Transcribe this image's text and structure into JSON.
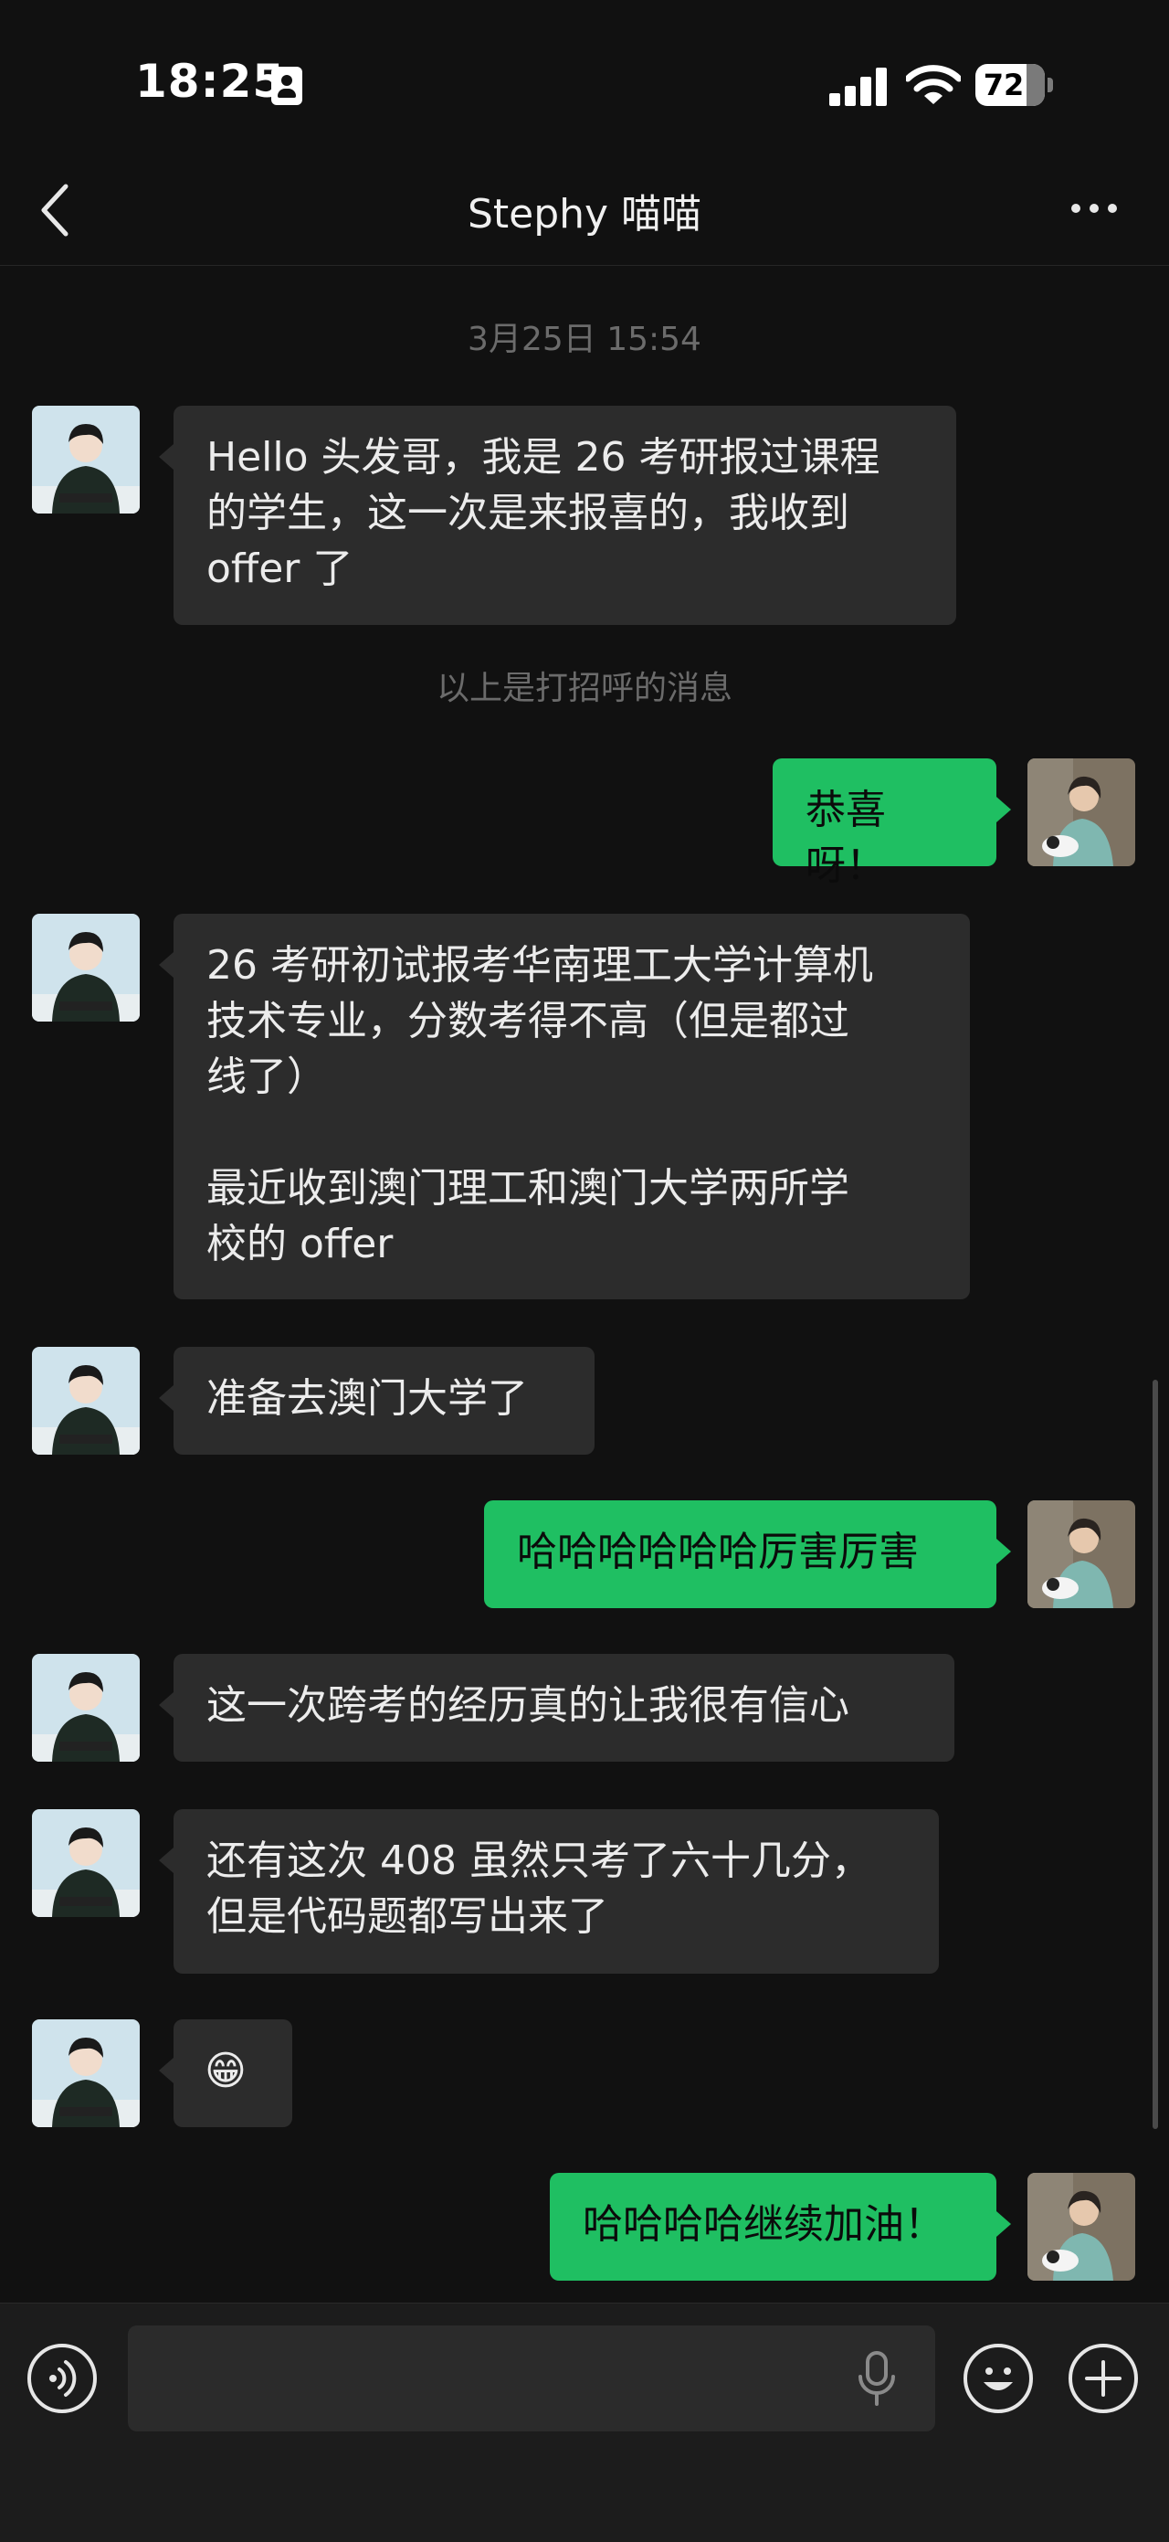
{
  "status_bar": {
    "time": "18:25",
    "battery": "72"
  },
  "header": {
    "title": "Stephy 喵喵"
  },
  "timestamp": "3月25日 15:54",
  "system_message": "以上是打招呼的消息",
  "messages": [
    {
      "side": "in",
      "text": "Hello 头发哥，我是 26 考研报过课程\n的学生，这一次是来报喜的，我收到\noffer 了"
    },
    {
      "side": "out",
      "text": "恭喜呀！"
    },
    {
      "side": "in",
      "text": "26 考研初试报考华南理工大学计算机\n技术专业，分数考得不高（但是都过\n线了）\n\n最近收到澳门理工和澳门大学两所学\n校的 offer"
    },
    {
      "side": "in",
      "text": "准备去澳门大学了"
    },
    {
      "side": "out",
      "text": "哈哈哈哈哈哈厉害厉害"
    },
    {
      "side": "in",
      "text": "这一次跨考的经历真的让我很有信心"
    },
    {
      "side": "in",
      "text": "还有这次 408 虽然只考了六十几分，\n但是代码题都写出来了"
    },
    {
      "side": "in",
      "text": "😁"
    },
    {
      "side": "out",
      "text": "哈哈哈哈继续加油！"
    }
  ],
  "input": {
    "placeholder": ""
  },
  "colors": {
    "accent_green": "#1fbf62",
    "bubble_dark": "#2c2c2c",
    "background": "#111111"
  },
  "icons": [
    "back-arrow-icon",
    "more-dots-icon",
    "voice-icon",
    "microphone-icon",
    "emoji-icon",
    "plus-icon"
  ]
}
